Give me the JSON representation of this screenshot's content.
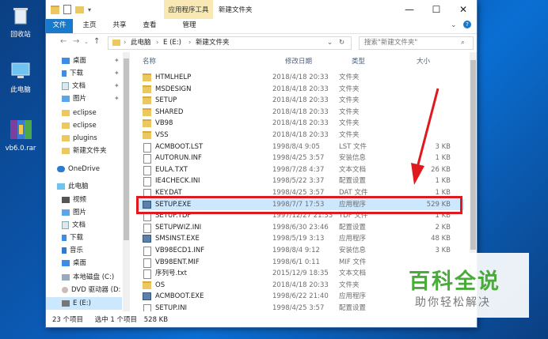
{
  "desktop": {
    "icons": [
      {
        "label": "回收站",
        "icon": "recycle-bin-icon"
      },
      {
        "label": "此电脑",
        "icon": "computer-icon"
      },
      {
        "label": "vb6.0.rar",
        "icon": "rar-archive-icon"
      }
    ]
  },
  "window": {
    "context_tab": "应用程序工具",
    "title": "新建文件夹",
    "controls": [
      "minimize-icon",
      "maximize-icon",
      "close-icon"
    ]
  },
  "ribbon": {
    "tabs": [
      "文件",
      "主页",
      "共享",
      "查看",
      "管理"
    ]
  },
  "address": {
    "crumbs": [
      "此电脑",
      "E (E:)",
      "新建文件夹"
    ],
    "search_placeholder": "搜索\"新建文件夹\""
  },
  "nav": {
    "items": [
      {
        "label": "桌面",
        "pinned": true
      },
      {
        "label": "下载",
        "pinned": true
      },
      {
        "label": "文档",
        "pinned": true
      },
      {
        "label": "图片",
        "pinned": true
      },
      {
        "label": "eclipse"
      },
      {
        "label": "eclipse"
      },
      {
        "label": "plugins"
      },
      {
        "label": "新建文件夹"
      },
      {
        "label": "OneDrive"
      },
      {
        "label": "此电脑"
      },
      {
        "label": "视频"
      },
      {
        "label": "图片"
      },
      {
        "label": "文档"
      },
      {
        "label": "下载"
      },
      {
        "label": "音乐"
      },
      {
        "label": "桌面"
      },
      {
        "label": "本地磁盘 (C:)"
      },
      {
        "label": "DVD 驱动器 (D:"
      },
      {
        "label": "E (E:)"
      }
    ]
  },
  "columns": [
    "名称",
    "修改日期",
    "类型",
    "大小"
  ],
  "files": [
    {
      "name": "HTMLHELP",
      "date": "2018/4/18 20:33",
      "type": "文件夹",
      "size": "",
      "kind": "folder"
    },
    {
      "name": "MSDESIGN",
      "date": "2018/4/18 20:33",
      "type": "文件夹",
      "size": "",
      "kind": "folder"
    },
    {
      "name": "SETUP",
      "date": "2018/4/18 20:33",
      "type": "文件夹",
      "size": "",
      "kind": "folder"
    },
    {
      "name": "SHARED",
      "date": "2018/4/18 20:33",
      "type": "文件夹",
      "size": "",
      "kind": "folder"
    },
    {
      "name": "VB98",
      "date": "2018/4/18 20:33",
      "type": "文件夹",
      "size": "",
      "kind": "folder"
    },
    {
      "name": "VSS",
      "date": "2018/4/18 20:33",
      "type": "文件夹",
      "size": "",
      "kind": "folder"
    },
    {
      "name": "ACMBOOT.LST",
      "date": "1998/8/4 9:05",
      "type": "LST 文件",
      "size": "3 KB",
      "kind": "file"
    },
    {
      "name": "AUTORUN.INF",
      "date": "1998/4/25 3:57",
      "type": "安装信息",
      "size": "1 KB",
      "kind": "file"
    },
    {
      "name": "EULA.TXT",
      "date": "1998/7/28 4:37",
      "type": "文本文档",
      "size": "26 KB",
      "kind": "file"
    },
    {
      "name": "IE4CHECK.INI",
      "date": "1998/5/22 3:37",
      "type": "配置设置",
      "size": "1 KB",
      "kind": "file"
    },
    {
      "name": "KEY.DAT",
      "date": "1998/4/25 3:57",
      "type": "DAT 文件",
      "size": "1 KB",
      "kind": "file"
    },
    {
      "name": "SETUP.EXE",
      "date": "1998/7/7 17:53",
      "type": "应用程序",
      "size": "529 KB",
      "kind": "exe",
      "selected": true
    },
    {
      "name": "SETUP.TDF",
      "date": "1997/12/27 21:33",
      "type": "TDF 文件",
      "size": "1 KB",
      "kind": "file"
    },
    {
      "name": "SETUPWIZ.INI",
      "date": "1998/6/30 23:46",
      "type": "配置设置",
      "size": "2 KB",
      "kind": "file"
    },
    {
      "name": "SMSINST.EXE",
      "date": "1998/5/19 3:13",
      "type": "应用程序",
      "size": "48 KB",
      "kind": "exe"
    },
    {
      "name": "VB98ECD1.INF",
      "date": "1998/8/4 9:12",
      "type": "安装信息",
      "size": "3 KB",
      "kind": "file"
    },
    {
      "name": "VB98ENT.MIF",
      "date": "1998/6/1 0:11",
      "type": "MIF 文件",
      "size": "",
      "kind": "file"
    },
    {
      "name": "序列号.txt",
      "date": "2015/12/9 18:35",
      "type": "文本文档",
      "size": "",
      "kind": "file"
    },
    {
      "name": "OS",
      "date": "2018/4/18 20:33",
      "type": "文件夹",
      "size": "",
      "kind": "folder"
    },
    {
      "name": "ACMBOOT.EXE",
      "date": "1998/6/22 21:40",
      "type": "应用程序",
      "size": "",
      "kind": "exe"
    },
    {
      "name": "SETUP.INI",
      "date": "1998/4/25 3:57",
      "type": "配置设置",
      "size": "",
      "kind": "file"
    }
  ],
  "status": {
    "count": "23 个项目",
    "selection": "选中 1 个项目",
    "size": "528 KB"
  },
  "watermark": {
    "title": "百科全说",
    "subtitle": "助你轻松解决"
  },
  "colors": {
    "highlight_border": "#e0191e",
    "arrow": "#e0191e",
    "file_tab": "#1979ca",
    "context_tab": "#f7e8b4"
  }
}
